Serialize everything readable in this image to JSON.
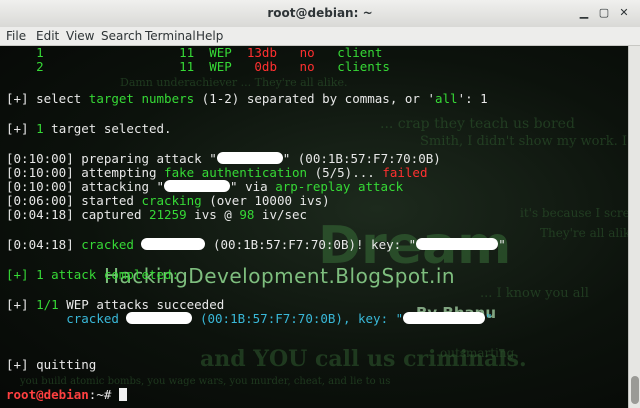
{
  "window": {
    "title": "root@debian: ~"
  },
  "menu": [
    "File",
    "Edit",
    "View",
    "Search",
    "Terminal",
    "Help"
  ],
  "table_rows": [
    {
      "num": "1",
      "ch": "11",
      "enc": "WEP",
      "power": "13db",
      "wps": "no",
      "client": "client"
    },
    {
      "num": "2",
      "ch": "11",
      "enc": "WEP",
      "power": "0db",
      "wps": "no",
      "client": "clients"
    }
  ],
  "lines": {
    "select_pre": "[+] select ",
    "select_target": "target numbers",
    "select_range": " (1-2) separated by commas, or '",
    "select_all": "all",
    "select_end": "': 1",
    "target_selected_pre": "[+] ",
    "target_selected_num": "1",
    "target_selected_post": " target selected.",
    "l1_time": "[0:10:00]",
    "l1_text": " preparing attack \"",
    "l1_mac": "\" (00:1B:57:F7:70:0B)",
    "l2_time": "[0:10:00]",
    "l2_text": " attempting ",
    "l2_green": "fake authentication",
    "l2_count": " (5/5)... ",
    "l2_failed": "failed",
    "l3_time": "[0:10:00]",
    "l3_text": " attacking \"",
    "l3_via": "\" via ",
    "l3_method": "arp-replay attack",
    "l4_time": "[0:06:00]",
    "l4_text": " started ",
    "l4_green": "cracking",
    "l4_rest": " (over 10000 ivs)",
    "l5_time": "[0:04:18]",
    "l5_text": " captured ",
    "l5_ivs": "21259",
    "l5_mid": " ivs @ ",
    "l5_rate": "98",
    "l5_end": " iv/sec",
    "l6_time": "[0:04:18]",
    "l6_cracked": " cracked",
    "l6_mac": " (00:1B:57:F7:70:0B)! key: \"",
    "l6_end": "\"",
    "attack_completed": "[+] 1 attack completed:",
    "succeeded_pre": "[+] ",
    "succeeded_frac": "1/1",
    "succeeded_post": " WEP attacks succeeded",
    "summary_cracked": "cracked",
    "summary_mac": " (00:1B:57:F7:70:0B), key: \"",
    "summary_end": "\"",
    "quitting": "[+] quitting",
    "prompt_user": "root@debian",
    "prompt_rest": ":~#"
  },
  "watermark": {
    "site": "HackingDevelopment.BlogSpot.in",
    "by": "By Bhanu",
    "dream": "Dream"
  },
  "colors": {
    "accent_green": "#36d936",
    "error_red": "#ff3030",
    "cyan": "#39b8d8"
  }
}
